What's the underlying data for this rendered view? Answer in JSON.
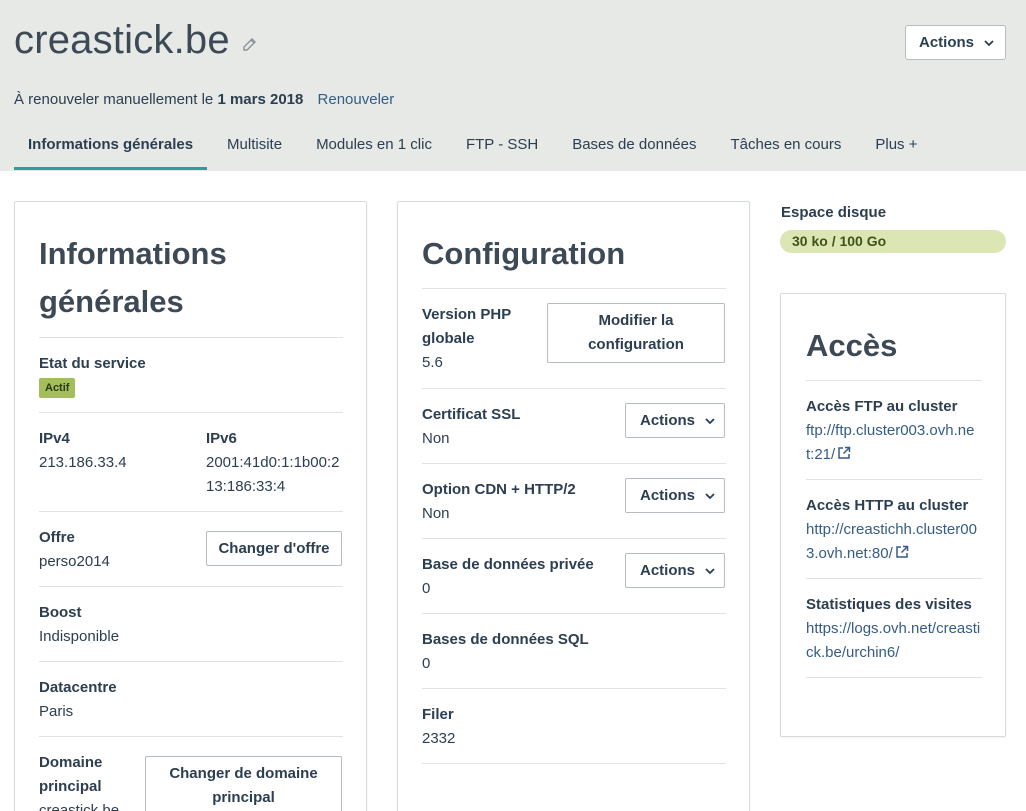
{
  "header": {
    "site_name": "creastick.be",
    "actions_label": "Actions",
    "renew_prefix": "À renouveler manuellement le",
    "renew_date": "1 mars 2018",
    "renew_link": "Renouveler"
  },
  "tabs": [
    {
      "label": "Informations générales",
      "active": true
    },
    {
      "label": "Multisite"
    },
    {
      "label": "Modules en 1 clic"
    },
    {
      "label": "FTP - SSH"
    },
    {
      "label": "Bases de données"
    },
    {
      "label": "Tâches en cours"
    },
    {
      "label": "Plus +"
    }
  ],
  "general": {
    "title": "Informations générales",
    "service_state_label": "Etat du service",
    "service_state_badge": "Actif",
    "ipv4_label": "IPv4",
    "ipv4_value": "213.186.33.4",
    "ipv6_label": "IPv6",
    "ipv6_value": "2001:41d0:1:1b00:213:186:33:4",
    "offer_label": "Offre",
    "offer_value": "perso2014",
    "offer_button": "Changer d'offre",
    "boost_label": "Boost",
    "boost_value": "Indisponible",
    "datacenter_label": "Datacentre",
    "datacenter_value": "Paris",
    "main_domain_label": "Domaine principal",
    "main_domain_value": "creastick.be",
    "main_domain_button": "Changer de domaine principal"
  },
  "configuration": {
    "title": "Configuration",
    "php_label": "Version PHP globale",
    "php_value": "5.6",
    "php_button": "Modifier la configuration",
    "ssl_label": "Certificat SSL",
    "ssl_value": "Non",
    "cdn_label": "Option CDN + HTTP/2",
    "cdn_value": "Non",
    "private_db_label": "Base de données privée",
    "private_db_value": "0",
    "sql_db_label": "Bases de données SQL",
    "sql_db_value": "0",
    "filer_label": "Filer",
    "filer_value": "2332",
    "actions_label": "Actions"
  },
  "disk": {
    "label": "Espace disque",
    "usage": "30 ko / 100 Go",
    "used_fraction": 3e-07
  },
  "access": {
    "title": "Accès",
    "ftp_label": "Accès FTP au cluster",
    "ftp_value": "ftp://ftp.cluster003.ovh.net:21/",
    "http_label": "Accès HTTP au cluster",
    "http_value": "http://creastichh.cluster003.ovh.net:80/",
    "stats_label": "Statistiques des visites",
    "stats_value": "https://logs.ovh.net/creastick.be/urchin6/"
  },
  "colors": {
    "header_bg": "#e6e9e6",
    "active_tab_underline": "#26a398",
    "badge_bg": "#a4be5c",
    "disk_bar_bg": "#dbe6b4",
    "link": "#365c85"
  }
}
